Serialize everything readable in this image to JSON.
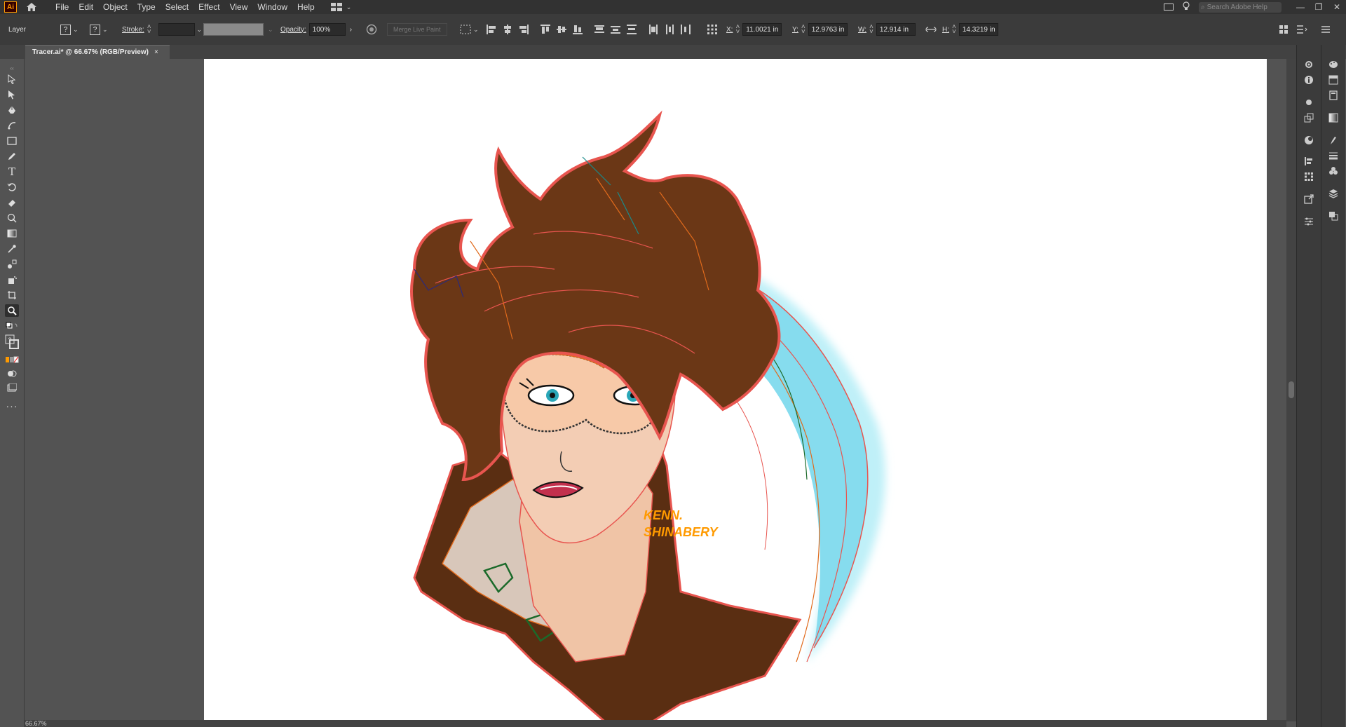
{
  "app": {
    "logo": "Ai"
  },
  "menu": [
    "File",
    "Edit",
    "Object",
    "Type",
    "Select",
    "Effect",
    "View",
    "Window",
    "Help"
  ],
  "search": {
    "placeholder": "Search Adobe Help"
  },
  "control": {
    "layer_label": "Layer",
    "q1": "?",
    "q2": "?",
    "stroke_label": "Stroke:",
    "opacity_label": "Opacity:",
    "opacity_value": "100%",
    "merge_label": "Merge Live Paint",
    "x_label": "X:",
    "x_value": "11.0021 in",
    "y_label": "Y:",
    "y_value": "12.9763 in",
    "w_label": "W:",
    "w_value": "12.914 in",
    "h_label": "H:",
    "h_value": "14.3219 in"
  },
  "document": {
    "tab_title": "Tracer.ai* @ 66.67% (RGB/Preview)",
    "close": "×"
  },
  "artwork": {
    "signature_line1": "KENN.",
    "signature_line2": "SHINABERY"
  },
  "status": {
    "zoom": "66.67%"
  },
  "colors": {
    "hair": "#6b3716",
    "skin": "#f3cdb4",
    "outline": "#e8554f",
    "glow": "#8fe0f0",
    "jacket": "#5a2e12",
    "accent": "#ff9a00"
  }
}
